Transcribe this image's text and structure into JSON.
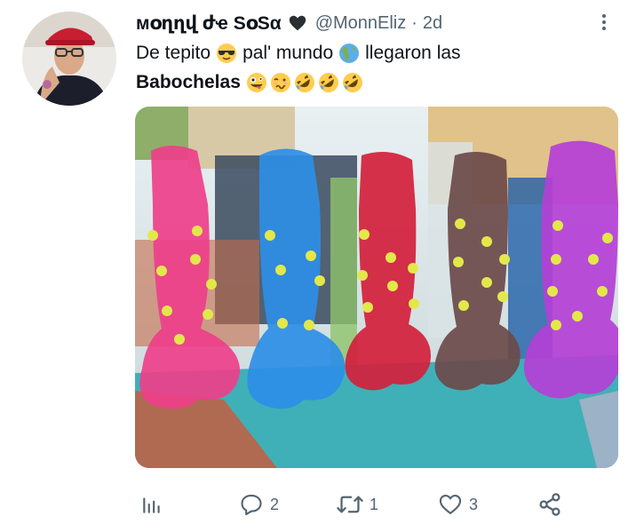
{
  "tweet": {
    "display_name": "ᴍօղղվ ժҽ SօSα",
    "handle": "@MonnEliz",
    "separator": "·",
    "time": "2d",
    "text_line1_a": "De tepito",
    "text_line1_b": "pal' mundo",
    "text_line1_c": "llegaron las",
    "text_line2_bold": "Babochelas",
    "emojis": [
      "black-heart",
      "smiling-face-with-sunglasses",
      "globe-americas",
      "zany-face",
      "woozy-face",
      "rolling-on-floor-laughing"
    ]
  },
  "actions": {
    "views": "",
    "replies": "2",
    "retweets": "1",
    "likes": "3",
    "share": ""
  },
  "colors": {
    "text": "#0f1419",
    "secondary": "#536471",
    "emoji_yellow": "#ffcc4d"
  }
}
